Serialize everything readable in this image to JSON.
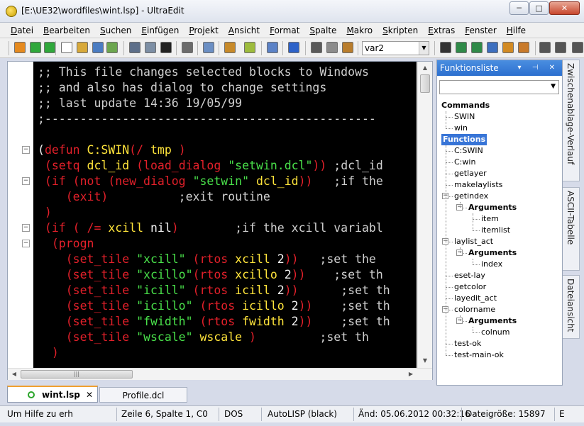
{
  "window": {
    "title": "[E:\\UE32\\wordfiles\\wint.lsp] - UltraEdit",
    "buttons": {
      "minimize": "─",
      "maximize": "□",
      "close": "✕"
    }
  },
  "menu": [
    "Datei",
    "Bearbeiten",
    "Suchen",
    "Einfügen",
    "Projekt",
    "Ansicht",
    "Format",
    "Spalte",
    "Makro",
    "Skripten",
    "Extras",
    "Fenster",
    "Hilfe"
  ],
  "toolbar": {
    "combo_value": "var2",
    "combo_arrow": "▼"
  },
  "editor": {
    "lines": [
      [
        {
          "t": ";; This file changes selected blocks to Windows",
          "c": "c-comment"
        }
      ],
      [
        {
          "t": ";; and also has dialog to change settings",
          "c": "c-comment"
        }
      ],
      [
        {
          "t": ";; last update 14:36 19/05/99",
          "c": "c-comment"
        }
      ],
      [
        {
          "t": ";-----------------------------------------------",
          "c": "c-comment"
        }
      ],
      [],
      [
        {
          "t": "(",
          "c": "c-white"
        },
        {
          "t": "defun ",
          "c": "c-red"
        },
        {
          "t": "C:SWIN",
          "c": "c-yellow"
        },
        {
          "t": "(/ ",
          "c": "c-red"
        },
        {
          "t": "tmp",
          "c": "c-yellow"
        },
        {
          "t": " )",
          "c": "c-red"
        }
      ],
      [
        {
          "t": " (setq ",
          "c": "c-red"
        },
        {
          "t": "dcl_id",
          "c": "c-yellow"
        },
        {
          "t": " (load_dialog ",
          "c": "c-red"
        },
        {
          "t": "\"setwin.dcl\"",
          "c": "c-green"
        },
        {
          "t": "))",
          "c": "c-red"
        },
        {
          "t": " ;dcl_id",
          "c": "c-comment"
        }
      ],
      [
        {
          "t": " (if ",
          "c": "c-red"
        },
        {
          "t": "(not ",
          "c": "c-red"
        },
        {
          "t": "(new_dialog ",
          "c": "c-red"
        },
        {
          "t": "\"setwin\"",
          "c": "c-green"
        },
        {
          "t": " ",
          "c": "c-white"
        },
        {
          "t": "dcl_id",
          "c": "c-yellow"
        },
        {
          "t": "))",
          "c": "c-red"
        },
        {
          "t": "   ;if the",
          "c": "c-comment"
        }
      ],
      [
        {
          "t": "    (exit)",
          "c": "c-red"
        },
        {
          "t": "          ;exit routine",
          "c": "c-comment"
        }
      ],
      [
        {
          "t": " )",
          "c": "c-red"
        }
      ],
      [
        {
          "t": " (if ( /= ",
          "c": "c-red"
        },
        {
          "t": "xcill",
          "c": "c-yellow"
        },
        {
          "t": " nil",
          "c": "c-white"
        },
        {
          "t": ")",
          "c": "c-red"
        },
        {
          "t": "        ;if the xcill variabl",
          "c": "c-comment"
        }
      ],
      [
        {
          "t": "  (progn",
          "c": "c-red"
        }
      ],
      [
        {
          "t": "    (set_tile ",
          "c": "c-red"
        },
        {
          "t": "\"xcill\"",
          "c": "c-green"
        },
        {
          "t": " (rtos ",
          "c": "c-red"
        },
        {
          "t": "xcill",
          "c": "c-yellow"
        },
        {
          "t": " 2",
          "c": "c-white"
        },
        {
          "t": "))",
          "c": "c-red"
        },
        {
          "t": "   ;set the",
          "c": "c-comment"
        }
      ],
      [
        {
          "t": "    (set_tile ",
          "c": "c-red"
        },
        {
          "t": "\"xcillo\"",
          "c": "c-green"
        },
        {
          "t": "(rtos ",
          "c": "c-red"
        },
        {
          "t": "xcillo",
          "c": "c-yellow"
        },
        {
          "t": " 2",
          "c": "c-white"
        },
        {
          "t": "))",
          "c": "c-red"
        },
        {
          "t": "    ;set th",
          "c": "c-comment"
        }
      ],
      [
        {
          "t": "    (set_tile ",
          "c": "c-red"
        },
        {
          "t": "\"icill\"",
          "c": "c-green"
        },
        {
          "t": " (rtos ",
          "c": "c-red"
        },
        {
          "t": "icill",
          "c": "c-yellow"
        },
        {
          "t": " 2",
          "c": "c-white"
        },
        {
          "t": "))",
          "c": "c-red"
        },
        {
          "t": "      ;set th",
          "c": "c-comment"
        }
      ],
      [
        {
          "t": "    (set_tile ",
          "c": "c-red"
        },
        {
          "t": "\"icillo\"",
          "c": "c-green"
        },
        {
          "t": " (rtos ",
          "c": "c-red"
        },
        {
          "t": "icillo",
          "c": "c-yellow"
        },
        {
          "t": " 2",
          "c": "c-white"
        },
        {
          "t": "))",
          "c": "c-red"
        },
        {
          "t": "    ;set th",
          "c": "c-comment"
        }
      ],
      [
        {
          "t": "    (set_tile ",
          "c": "c-red"
        },
        {
          "t": "\"fwidth\"",
          "c": "c-green"
        },
        {
          "t": " (rtos ",
          "c": "c-red"
        },
        {
          "t": "fwidth",
          "c": "c-yellow"
        },
        {
          "t": " 2",
          "c": "c-white"
        },
        {
          "t": "))",
          "c": "c-red"
        },
        {
          "t": "    ;set th",
          "c": "c-comment"
        }
      ],
      [
        {
          "t": "    (set_tile ",
          "c": "c-red"
        },
        {
          "t": "\"wscale\"",
          "c": "c-green"
        },
        {
          "t": " ",
          "c": "c-white"
        },
        {
          "t": "wscale",
          "c": "c-yellow"
        },
        {
          "t": " )",
          "c": "c-red"
        },
        {
          "t": "         ;set th",
          "c": "c-comment"
        }
      ],
      [
        {
          "t": "  )",
          "c": "c-red"
        }
      ]
    ]
  },
  "function_list": {
    "title": "Funktionsliste",
    "controls": "▾ ⊣ ✕",
    "combo_value": "",
    "combo_arrow": "▼",
    "tree": {
      "commands_label": "Commands",
      "commands": [
        "SWIN",
        "win"
      ],
      "functions_label": "Functions",
      "functions": [
        "C:SWIN",
        "C:win",
        "getlayer",
        "makelaylists",
        "getindex",
        "laylist_act",
        "eset-lay",
        "getcolor",
        "layedit_act",
        "colorname",
        "test-ok",
        "test-main-ok"
      ],
      "arguments_label": "Arguments",
      "getindex_args": [
        "item",
        "itemlist"
      ],
      "laylist_act_args": [
        "index"
      ],
      "colorname_args": [
        "colnum"
      ]
    }
  },
  "side_tabs": [
    "Zwischenablage-Verlauf",
    "ASCII-Tabelle",
    "Dateiansicht"
  ],
  "file_tabs": {
    "active": "wint.lsp",
    "active_close": "✕",
    "inactive": "Profile.dcl"
  },
  "scroll": {
    "up": "▲",
    "down": "▼",
    "left": "◀",
    "right": "▶",
    "grip": "|||"
  },
  "statusbar": {
    "help": "Um Hilfe zu erh",
    "position": "Zeile 6, Spalte 1, C0",
    "lineend": "DOS",
    "syntax": "AutoLISP (black)",
    "modified": "Änd: 05.06.2012 00:32:16",
    "filesize": "Dateigröße: 15897",
    "extra": "E"
  }
}
